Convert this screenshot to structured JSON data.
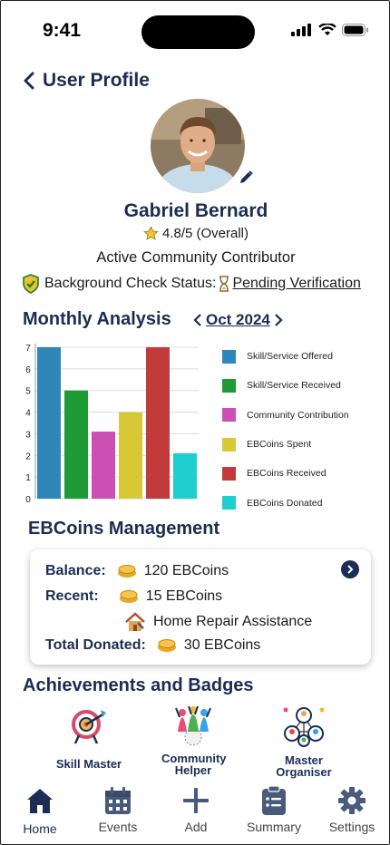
{
  "status_bar": {
    "time": "9:41"
  },
  "header": {
    "title": "User Profile"
  },
  "profile": {
    "name": "Gabriel Bernard",
    "rating": "4.8/5 (Overall)",
    "role": "Active Community Contributor",
    "background_check_label": "Background Check Status:",
    "background_check_value": "Pending Verification"
  },
  "monthly_analysis": {
    "title": "Monthly Analysis",
    "month": "Oct 2024"
  },
  "chart_data": {
    "type": "bar",
    "categories": [
      "Skill/Service Offered",
      "Skill/Service Received",
      "Community Contribution",
      "EBCoins Spent",
      "EBCoins Received",
      "EBCoins Donated"
    ],
    "values": [
      7,
      5,
      3.1,
      4,
      7,
      2.1
    ],
    "colors": [
      "#2f86b8",
      "#1f9a34",
      "#cc4fb3",
      "#d8c836",
      "#c13b3b",
      "#1fcfcf"
    ],
    "yticks": [
      0,
      1,
      2,
      3,
      4,
      5,
      6,
      7
    ],
    "ylim": [
      0,
      7
    ],
    "grid": true,
    "legend": "right"
  },
  "ebcoins": {
    "title": "EBCoins Management",
    "balance_label": "Balance:",
    "balance_value": "120 EBCoins",
    "recent_label": "Recent:",
    "recent_value": "15 EBCoins",
    "recent_desc": "Home Repair Assistance",
    "donated_label": "Total Donated:",
    "donated_value": "30 EBCoins"
  },
  "achievements": {
    "title": "Achievements and Badges",
    "badges": [
      {
        "label": "Skill Master",
        "icon": "target-arrow-icon"
      },
      {
        "label": "Community Helper",
        "icon": "community-group-icon"
      },
      {
        "label": "Master Organiser",
        "icon": "network-people-icon"
      }
    ]
  },
  "tabbar": {
    "tabs": [
      {
        "label": "Home",
        "icon": "home-icon"
      },
      {
        "label": "Events",
        "icon": "calendar-icon"
      },
      {
        "label": "Add",
        "icon": "plus-icon"
      },
      {
        "label": "Summary",
        "icon": "clipboard-icon"
      },
      {
        "label": "Settings",
        "icon": "gear-icon"
      }
    ],
    "active": "Home"
  }
}
